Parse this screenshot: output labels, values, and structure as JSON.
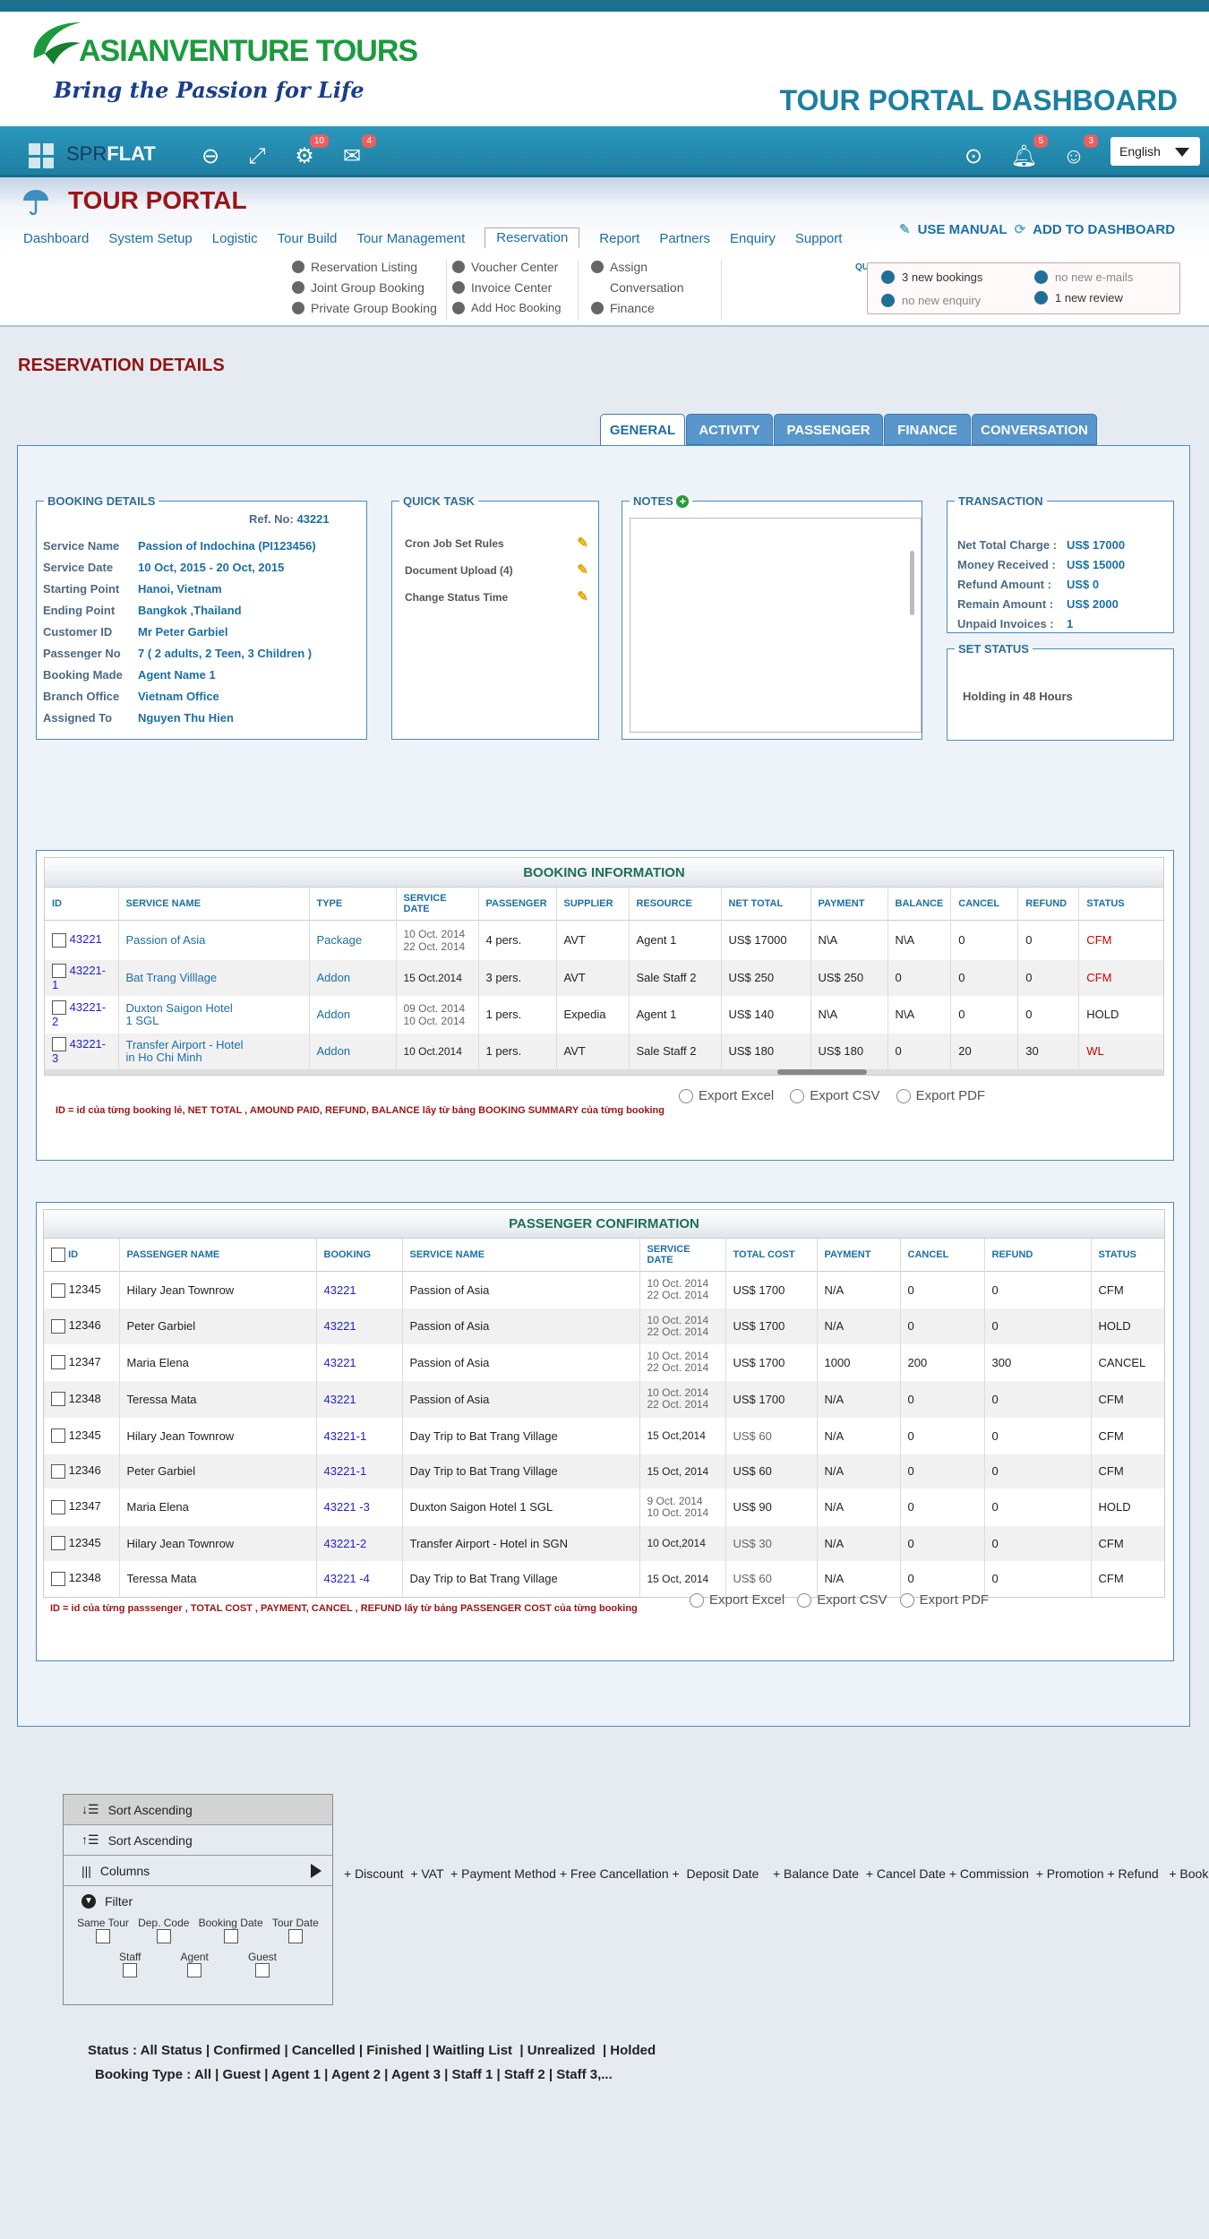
{
  "brand": {
    "name_part1": "ASIAN",
    "name_part2": "VENTURE TOURS",
    "tagline": "Bring the Passion for Life"
  },
  "header": {
    "title": "TOUR PORTAL DASHBOARD"
  },
  "toolbar": {
    "app_name_light": "SPR",
    "app_name_bold": "FLAT",
    "settings_badge": "10",
    "mail_badge": "4",
    "bell_badge": "5",
    "users_badge": "3",
    "language": "English"
  },
  "portal": {
    "title": "TOUR PORTAL",
    "use_manual": "USE MANUAL",
    "add_to_dashboard": "ADD TO  DASHBOARD"
  },
  "nav": [
    "Dashboard",
    "System Setup",
    "Logistic",
    "Tour Build",
    "Tour Management",
    "Reservation",
    "Report",
    "Partners",
    "Enquiry",
    "Support"
  ],
  "submenu": {
    "col1": [
      "Reservation Listing",
      "Joint Group Booking",
      "Private Group Booking"
    ],
    "col2": [
      "Voucher Center",
      "Invoice Center",
      "Add Hoc Booking"
    ],
    "col3": [
      "Assign",
      "Conversation",
      "Finance"
    ]
  },
  "quick": {
    "label": "QUICK",
    "items": [
      "3 new bookings",
      "no new e-mails",
      "no new enquiry",
      "1 new review"
    ]
  },
  "page_title": "RESERVATION DETAILS",
  "tabs": [
    "GENERAL",
    "ACTIVITY",
    "PASSENGER",
    "FINANCE",
    "CONVERSATION"
  ],
  "booking_details": {
    "legend": "BOOKING DETAILS",
    "ref_label": "Ref. No:",
    "ref_value": "43221",
    "rows": [
      {
        "k": "Service Name",
        "v": "Passion of Indochina (PI123456)"
      },
      {
        "k": "Service  Date",
        "v": "10 Oct, 2015  - 20 Oct, 2015"
      },
      {
        "k": "Starting Point",
        "v": "Hanoi, Vietnam"
      },
      {
        "k": "Ending Point",
        "v": "Bangkok ,Thailand"
      },
      {
        "k": "Customer  ID",
        "v": "Mr Peter Garbiel"
      },
      {
        "k": "Passenger No",
        "v": "7  ( 2 adults, 2 Teen, 3 Children )"
      },
      {
        "k": "Booking Made",
        "v": "Agent Name 1"
      },
      {
        "k": "Branch Office",
        "v": "Vietnam Office"
      },
      {
        "k": "Assigned  To",
        "v": "Nguyen Thu Hien"
      }
    ]
  },
  "quick_task": {
    "legend": "QUICK TASK",
    "items": [
      "Cron Job Set Rules",
      "Document Upload (4)",
      "Change Status Time"
    ]
  },
  "notes": {
    "legend": "NOTES"
  },
  "transaction": {
    "legend": "TRANSACTION",
    "rows": [
      {
        "k": "Net Total Charge :",
        "v": "US$ 17000"
      },
      {
        "k": "Money Received :",
        "v": "US$ 15000"
      },
      {
        "k": "Refund Amount  :",
        "v": "US$ 0"
      },
      {
        "k": "Remain Amount  :",
        "v": "US$ 2000"
      },
      {
        "k": "Unpaid Invoices  :",
        "v": "1"
      }
    ]
  },
  "set_status": {
    "legend": "SET STATUS",
    "value": "Holding in 48 Hours"
  },
  "booking_info": {
    "title": "BOOKING INFORMATION",
    "headers": [
      "ID",
      "SERVICE NAME",
      "TYPE",
      "SERVICE DATE",
      "PASSENGER",
      "SUPPLIER",
      "RESOURCE",
      "NET TOTAL",
      "PAYMENT",
      "BALANCE",
      "CANCEL",
      "REFUND",
      "STATUS"
    ],
    "rows": [
      {
        "id": "43221",
        "service": "Passion of Asia",
        "type": "Package",
        "date": "10 Oct. 2014\n22 Oct. 2014",
        "pax": "4 pers.",
        "supplier": "AVT",
        "resource": "Agent 1",
        "net": "US$ 17000",
        "payment": "N\\A",
        "balance": "N\\A",
        "cancel": "0",
        "refund": "0",
        "status": "CFM",
        "status_red": true
      },
      {
        "id": "43221-1",
        "service": "Bat Trang Villlage",
        "type": "Addon",
        "date": "15 Oct.2014",
        "pax": "3 pers.",
        "supplier": "AVT",
        "resource": "Sale Staff 2",
        "net": "US$ 250",
        "payment": "US$ 250",
        "balance": "0",
        "cancel": "0",
        "refund": "0",
        "status": "CFM",
        "status_red": true
      },
      {
        "id": "43221-2",
        "service": "Duxton Saigon Hotel\n1 SGL",
        "type": "Addon",
        "date": "09 Oct. 2014\n10 Oct. 2014",
        "pax": "1 pers.",
        "supplier": "Expedia",
        "resource": "Agent 1",
        "net": "US$ 140",
        "payment": "N\\A",
        "balance": "N\\A",
        "cancel": "0",
        "refund": "0",
        "status": "HOLD",
        "status_red": false
      },
      {
        "id": "43221-3",
        "service": "Transfer Airport - Hotel\nin Ho Chi Minh",
        "type": "Addon",
        "date": "10 Oct.2014",
        "pax": "1 pers.",
        "supplier": "AVT",
        "resource": "Sale Staff 2",
        "net": "US$ 180",
        "payment": "US$ 180",
        "balance": "0",
        "cancel": "20",
        "refund": "30",
        "status": "WL",
        "status_red": true
      }
    ],
    "note": "ID = id của từng booking  lẻ, NET TOTAL , AMOUND PAID, REFUND, BALANCE lấy từ bảng BOOKING SUMMARY  của từng booking",
    "exports": [
      "Export Excel",
      "Export CSV",
      "Export PDF"
    ]
  },
  "passenger_conf": {
    "title": "PASSENGER CONFIRMATION",
    "headers": [
      "ID",
      "PASSENGER  NAME",
      "BOOKING",
      "SERVICE NAME",
      "SERVICE DATE",
      "TOTAL COST",
      "PAYMENT",
      "CANCEL",
      "REFUND",
      "STATUS"
    ],
    "rows": [
      {
        "id": "12345",
        "name": "Hilary  Jean  Townrow",
        "booking": "43221",
        "service": "Passion of Asia",
        "date": "10 Oct. 2014\n22 Oct. 2014",
        "cost": "US$ 1700",
        "payment": "N/A",
        "cancel": "0",
        "refund": "0",
        "status": "CFM"
      },
      {
        "id": "12346",
        "name": "Peter Garbiel",
        "booking": "43221",
        "service": "Passion of Asia",
        "date": "10 Oct. 2014\n22 Oct. 2014",
        "cost": "US$ 1700",
        "payment": "N/A",
        "cancel": "0",
        "refund": "0",
        "status": "HOLD"
      },
      {
        "id": "12347",
        "name": "Maria Elena",
        "booking": "43221",
        "service": "Passion of Asia",
        "date": "10 Oct. 2014\n22 Oct. 2014",
        "cost": "US$ 1700",
        "payment": "1000",
        "cancel": "200",
        "refund": "300",
        "status": "CANCEL"
      },
      {
        "id": "12348",
        "name": "Teressa Mata",
        "booking": "43221",
        "service": "Passion of Asia",
        "date": "10 Oct. 2014\n22 Oct. 2014",
        "cost": "US$ 1700",
        "payment": "N/A",
        "cancel": "0",
        "refund": "0",
        "status": "CFM"
      },
      {
        "id": "12345",
        "name": "Hilary  Jean  Townrow",
        "booking": "43221-1",
        "service": "Day Trip to Bat Trang Village",
        "date": "15 Oct,2014",
        "cost": "US$ 60",
        "payment": "N/A",
        "cancel": "0",
        "refund": "0",
        "status": "CFM"
      },
      {
        "id": "12346",
        "name": "Peter Garbiel",
        "booking": "43221-1",
        "service": "Day Trip to Bat Trang Village",
        "date": "15 Oct, 2014",
        "cost": "US$ 60",
        "payment": "N/A",
        "cancel": "0",
        "refund": "0",
        "status": "CFM"
      },
      {
        "id": "12347",
        "name": "Maria Elena",
        "booking": "43221 -3",
        "service": "Duxton Saigon  Hotel 1 SGL",
        "date": "9 Oct. 2014\n10 Oct. 2014",
        "cost": "US$ 90",
        "payment": "N/A",
        "cancel": "0",
        "refund": "0",
        "status": "HOLD"
      },
      {
        "id": "12345",
        "name": "Hilary  Jean  Townrow",
        "booking": "43221-2",
        "service": "Transfer Airport - Hotel in SGN",
        "date": "10 Oct,2014",
        "cost": "US$ 30",
        "payment": "N/A",
        "cancel": "0",
        "refund": "0",
        "status": "CFM"
      },
      {
        "id": "12348",
        "name": "Teressa Mata",
        "booking": "43221 -4",
        "service": "Day Trip to Bat Trang Village",
        "date": "15 Oct, 2014",
        "cost": "US$ 60",
        "payment": "N/A",
        "cancel": "0",
        "refund": "0",
        "status": "CFM"
      }
    ],
    "note": "ID = id của từng passsenger  , TOTAL COST  , PAYMENT, CANCEL , REFUND  lấy từ bảng PASSENGER COST  của từng booking",
    "exports": [
      "Export Excel",
      "Export CSV",
      "Export PDF"
    ]
  },
  "context_menu": {
    "sort_asc_1": "Sort Ascending",
    "sort_asc_2": "Sort Ascending",
    "columns": "Columns",
    "filter": "Filter",
    "filter_opts_row1": [
      "Same Tour",
      "Dep. Code",
      "Booking Date",
      "Tour Date"
    ],
    "filter_opts_row2": [
      "Staff",
      "Agent",
      "Guest"
    ],
    "extra_columns": "+ Discount  + VAT  + Payment Method + Free Cancellation +  Deposit Date    + Balance Date  + Cancel Date + Commission  + Promotion + Refund   + Booked by"
  },
  "filters": {
    "status_line": "Status : All Status | Confirmed | Cancelled | Finished | Waitling List  | Unrealized  | Holded",
    "booking_type_line": "Booking Type : All | Guest | Agent 1 | Agent 2 | Agent 3 | Staff 1 | Staff 2 | Staff 3,..."
  }
}
